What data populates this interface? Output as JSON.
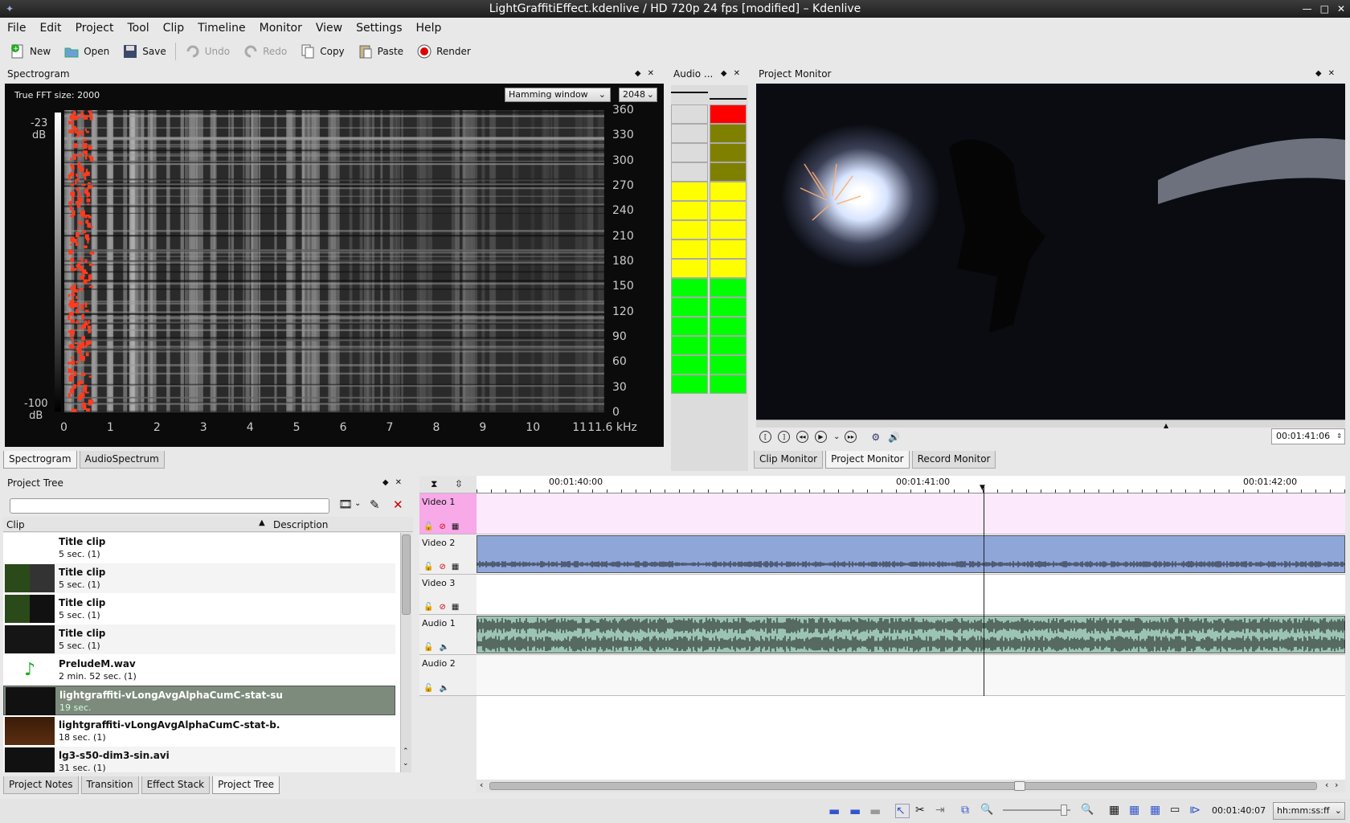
{
  "window": {
    "title": "LightGraffitiEffect.kdenlive / HD 720p 24 fps [modified] – Kdenlive",
    "buttons": [
      "—",
      "□",
      "✕"
    ]
  },
  "menu": [
    "File",
    "Edit",
    "Project",
    "Tool",
    "Clip",
    "Timeline",
    "Monitor",
    "View",
    "Settings",
    "Help"
  ],
  "toolbar": {
    "new": "New",
    "open": "Open",
    "save": "Save",
    "undo": "Undo",
    "redo": "Redo",
    "copy": "Copy",
    "paste": "Paste",
    "render": "Render"
  },
  "spectrogram": {
    "title": "Spectrogram",
    "fft_label": "True FFT size: 2000",
    "window_select": "Hamming window",
    "size_select": "2048",
    "db_top": "-23",
    "db_bottom": "-100",
    "db_unit": "dB",
    "y_ticks": [
      "360",
      "330",
      "300",
      "270",
      "240",
      "210",
      "180",
      "150",
      "120",
      "90",
      "60",
      "30",
      "0"
    ],
    "x_ticks": [
      "0",
      "1",
      "2",
      "3",
      "4",
      "5",
      "6",
      "7",
      "8",
      "9",
      "10",
      "11"
    ],
    "x_end": "11.6 kHz"
  },
  "spectro_tabs": [
    "Spectrogram",
    "AudioSpectrum"
  ],
  "audio_meter": {
    "title": "Audio ...",
    "colors": {
      "red": "#ff0000",
      "olive": "#808000",
      "yellow": "#ffff00",
      "green": "#00ff00"
    }
  },
  "project_monitor": {
    "title": "Project Monitor",
    "timecode": "00:01:41:06"
  },
  "monitor_tabs": [
    "Clip Monitor",
    "Project Monitor",
    "Record Monitor"
  ],
  "project_tree": {
    "title": "Project Tree",
    "col_clip": "Clip",
    "col_desc": "Description",
    "clips": [
      {
        "name": "Title clip",
        "dur": "5 sec. (1)"
      },
      {
        "name": "Title clip",
        "dur": "5 sec. (1)"
      },
      {
        "name": "Title clip",
        "dur": "5 sec. (1)"
      },
      {
        "name": "Title clip",
        "dur": "5 sec. (1)"
      },
      {
        "name": "PreludeM.wav",
        "dur": "2 min. 52 sec. (1)"
      },
      {
        "name": "lightgraffiti-vLongAvgAlphaCumC-stat-su",
        "dur": "19 sec."
      },
      {
        "name": "lightgraffiti-vLongAvgAlphaCumC-stat-b.",
        "dur": "18 sec. (1)"
      },
      {
        "name": "lg3-s50-dim3-sin.avi",
        "dur": "31 sec. (1)"
      }
    ]
  },
  "bottom_tabs": [
    "Project Notes",
    "Transition",
    "Effect Stack",
    "Project Tree"
  ],
  "timeline": {
    "ruler": [
      "00:01:40:00",
      "00:01:41:00",
      "00:01:42:00"
    ],
    "tracks": [
      "Video 1",
      "Video 2",
      "Video 3",
      "Audio 1",
      "Audio 2"
    ]
  },
  "status": {
    "timecode": "00:01:40:07",
    "format": "hh:mm:ss:ff"
  }
}
